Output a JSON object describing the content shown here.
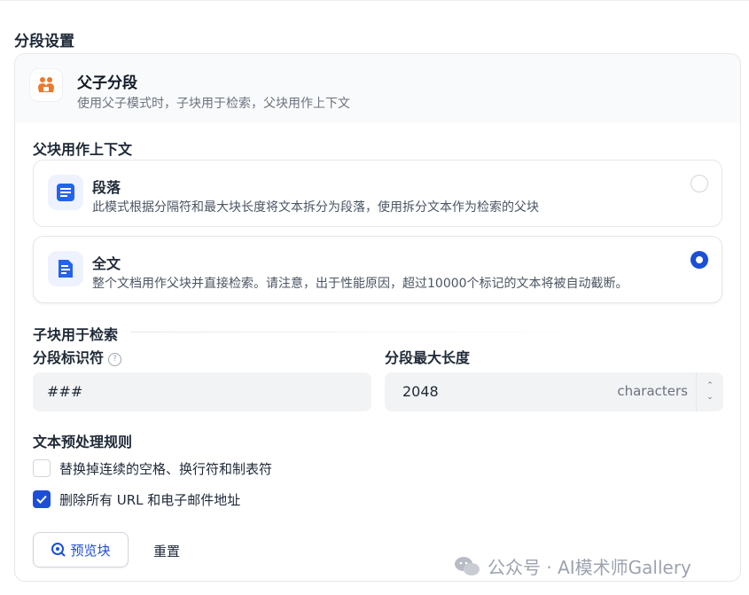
{
  "section_title": "分段设置",
  "mode": {
    "title": "父子分段",
    "description": "使用父子模式时，子块用于检索，父块用作上下文"
  },
  "parent": {
    "heading": "父块用作上下文",
    "options": [
      {
        "title": "段落",
        "description": "此模式根据分隔符和最大块长度将文本拆分为段落，使用拆分文本作为检索的父块",
        "selected": false
      },
      {
        "title": "全文",
        "description": "整个文档用作父块并直接检索。请注意，出于性能原因，超过10000个标记的文本将被自动截断。",
        "selected": true
      }
    ]
  },
  "child": {
    "heading": "子块用于检索",
    "separator_label": "分段标识符",
    "separator_value": "###",
    "max_length_label": "分段最大长度",
    "max_length_value": "2048",
    "max_length_unit": "characters"
  },
  "preprocess": {
    "heading": "文本预处理规则",
    "rules": [
      {
        "label": "替换掉连续的空格、换行符和制表符",
        "checked": false
      },
      {
        "label": "删除所有 URL 和电子邮件地址",
        "checked": true
      }
    ]
  },
  "actions": {
    "preview_label": "预览块",
    "reset_label": "重置"
  },
  "watermark": "公众号 · AI模术师Gallery",
  "colors": {
    "accent": "#1d4ed8",
    "mode_icon": "#ea7a2c"
  }
}
